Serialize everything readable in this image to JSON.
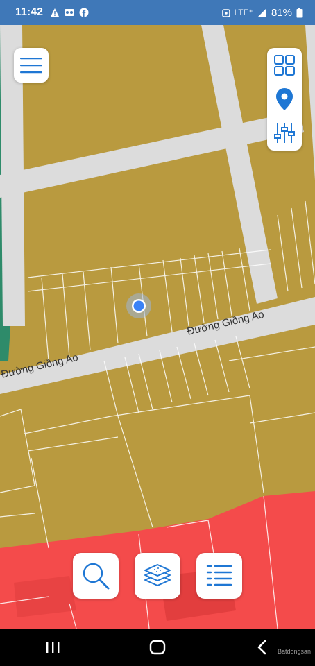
{
  "status_bar": {
    "time": "11:42",
    "network": "LTE⁺",
    "battery": "81%",
    "left_icons": [
      "warning-icon",
      "voicemail-icon",
      "facebook-icon"
    ],
    "right_icons": [
      "alarm-icon",
      "signal-icon",
      "battery-icon"
    ]
  },
  "map": {
    "streets": [
      {
        "label": "Đường Giồng Ao"
      },
      {
        "label": "Đường Giồng Ao"
      }
    ],
    "colors": {
      "land": "#b99a3f",
      "road": "#dcdcdc",
      "zone_red": "#f44b4b",
      "water": "#2e8b6a",
      "location_dot": "#3b82f6"
    }
  },
  "controls": {
    "menu": {
      "icon": "hamburger-menu-icon"
    },
    "right_panel": [
      {
        "icon": "grid-icon"
      },
      {
        "icon": "location-pin-icon"
      },
      {
        "icon": "filter-sliders-icon"
      }
    ],
    "bottom": [
      {
        "icon": "search-icon"
      },
      {
        "icon": "layers-icon"
      },
      {
        "icon": "list-icon"
      }
    ],
    "accent_color": "#1f77d4"
  },
  "watermark": "Batdongsan",
  "nav_bar": {
    "buttons": [
      "recent-apps-icon",
      "home-icon",
      "back-icon"
    ]
  }
}
